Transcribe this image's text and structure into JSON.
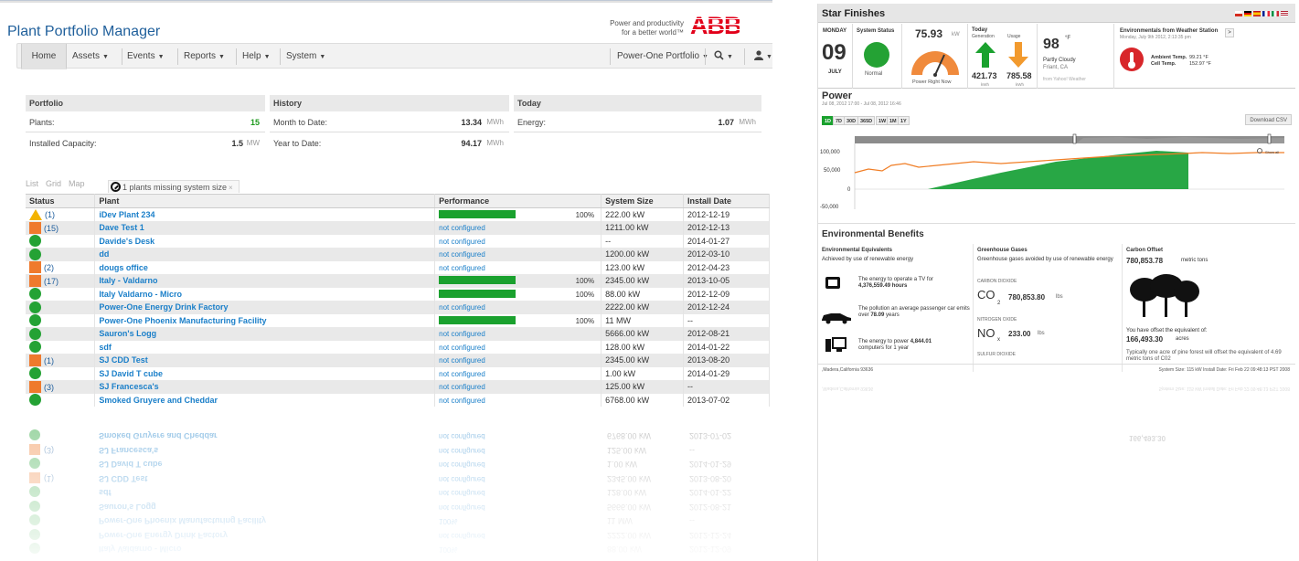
{
  "app": {
    "title": "Plant Portfolio Manager",
    "tagline_1": "Power and productivity",
    "tagline_2": "for a better world™",
    "logo_text": "ABB"
  },
  "nav": {
    "home": "Home",
    "assets": "Assets",
    "events": "Events",
    "reports": "Reports",
    "help": "Help",
    "system": "System",
    "portfolio": "Power-One Portfolio",
    "search_icon": "search-icon",
    "user_icon": "user-icon"
  },
  "summary": {
    "portfolio": {
      "title": "Portfolio",
      "plants_label": "Plants:",
      "plants_value": "15",
      "capacity_label": "Installed Capacity:",
      "capacity_value": "1.5",
      "capacity_unit": "MW"
    },
    "history": {
      "title": "History",
      "mtd_label": "Month to Date:",
      "mtd_value": "13.34",
      "mtd_unit": "MWh",
      "ytd_label": "Year to Date:",
      "ytd_value": "94.17",
      "ytd_unit": "MWh"
    },
    "today": {
      "title": "Today",
      "energy_label": "Energy:",
      "energy_value": "1.07",
      "energy_unit": "MWh"
    }
  },
  "tabs": {
    "list": "List",
    "grid": "Grid",
    "map": "Map",
    "missing": "1 plants missing system size"
  },
  "table": {
    "headers": [
      "Status",
      "Plant",
      "Performance",
      "System Size",
      "Install Date"
    ],
    "rows": [
      {
        "status": "warning",
        "count": "(1)",
        "plant": "iDev Plant 234",
        "perf": "100%",
        "size": "222.00 kW",
        "date": "2012-12-19"
      },
      {
        "status": "orange",
        "count": "(15)",
        "plant": "Dave Test 1",
        "perf": "not configured",
        "size": "1211.00 kW",
        "date": "2012-12-13"
      },
      {
        "status": "green",
        "count": "",
        "plant": "Davide's Desk",
        "perf": "not configured",
        "size": "--",
        "date": "2014-01-27"
      },
      {
        "status": "green",
        "count": "",
        "plant": "dd",
        "perf": "not configured",
        "size": "1200.00 kW",
        "date": "2012-03-10"
      },
      {
        "status": "orange",
        "count": "(2)",
        "plant": "dougs office",
        "perf": "not configured",
        "size": "123.00 kW",
        "date": "2012-04-23"
      },
      {
        "status": "orange",
        "count": "(17)",
        "plant": "Italy - Valdarno",
        "perf": "100%",
        "size": "2345.00 kW",
        "date": "2013-10-05"
      },
      {
        "status": "green",
        "count": "",
        "plant": "Italy Valdarno - Micro",
        "perf": "100%",
        "size": "88.00 kW",
        "date": "2012-12-09"
      },
      {
        "status": "green",
        "count": "",
        "plant": "Power-One Energy Drink Factory",
        "perf": "not configured",
        "size": "2222.00 kW",
        "date": "2012-12-24"
      },
      {
        "status": "green",
        "count": "",
        "plant": "Power-One Phoenix Manufacturing Facility",
        "perf": "100%",
        "size": "11 MW",
        "date": "--"
      },
      {
        "status": "green",
        "count": "",
        "plant": "Sauron's Logg",
        "perf": "not configured",
        "size": "5666.00 kW",
        "date": "2012-08-21"
      },
      {
        "status": "green",
        "count": "",
        "plant": "sdf",
        "perf": "not configured",
        "size": "128.00 kW",
        "date": "2014-01-22"
      },
      {
        "status": "orange",
        "count": "(1)",
        "plant": "SJ CDD Test",
        "perf": "not configured",
        "size": "2345.00 kW",
        "date": "2013-08-20"
      },
      {
        "status": "green",
        "count": "",
        "plant": "SJ David T cube",
        "perf": "not configured",
        "size": "1.00 kW",
        "date": "2014-01-29"
      },
      {
        "status": "orange",
        "count": "(3)",
        "plant": "SJ Francesca's",
        "perf": "not configured",
        "size": "125.00 kW",
        "date": "--"
      },
      {
        "status": "green",
        "count": "",
        "plant": "Smoked Gruyere and Cheddar",
        "perf": "not configured",
        "size": "6768.00 kW",
        "date": "2013-07-02"
      }
    ]
  },
  "starfinishes": {
    "title": "Star Finishes",
    "day": "MONDAY",
    "date": "09",
    "month": "JULY",
    "status_label": "System Status",
    "status_text": "Normal",
    "power_value": "75.93",
    "power_unit": "kW",
    "power_caption": "Power Right Now",
    "today_label": "Today",
    "generation_label": "Generation",
    "usage_label": "Usage",
    "generation_value": "421.73",
    "usage_value": "785.58",
    "kwh": "kWh",
    "temp": "98",
    "temp_unit": "°F",
    "weather": "Partly Cloudy",
    "location": "Friant, CA",
    "weather_source": "from Yahoo! Weather",
    "env_title": "Environmentals from Weather Station",
    "env_date": "Monday, July 9th 2012, 2:13:35 pm",
    "ambient_label": "Ambient Temp.",
    "ambient_value": "99.21 °F",
    "cell_label": "Cell Temp.",
    "cell_value": "152.97 °F",
    "power_title": "Power",
    "power_range": "Jul 08, 2012 17:00 - Jul 08, 2012 16:46",
    "ranges": [
      "1D",
      "7D",
      "30D",
      "365D",
      "1W",
      "1M",
      "1Y"
    ],
    "download": "Download CSV",
    "y_ticks": [
      "100,000",
      "50,000",
      "0",
      "-50,000"
    ],
    "show_all": "Show all",
    "env_benefits": "Environmental Benefits",
    "eq_title": "Environmental Equivalents",
    "eq_sub": "Achieved by use of renewable energy",
    "eq_tv": "The energy to operate a TV for",
    "eq_tv_val": "4,376,559.49 hours",
    "eq_car": "The pollution an average passenger car emits over",
    "eq_car_val": "78.09",
    "eq_car_unit": "years",
    "eq_pc": "The energy to power",
    "eq_pc_val": "4,844.01",
    "eq_pc_tail": "computers for 1 year",
    "gg_title": "Greenhouse Gases",
    "gg_sub": "Greenhouse gases avoided by use of renewable energy",
    "co2_label": "CARBON DIOXIDE",
    "co2_sym": "CO",
    "co2_sub": "2",
    "co2_val": "780,853.80",
    "co2_unit": "lbs",
    "nox_label": "NITROGEN OXIDE",
    "nox_sym": "NO",
    "nox_sub": "x",
    "nox_val": "233.00",
    "nox_unit": "lbs",
    "so2_label": "SULFUR DIOXIDE",
    "co_title": "Carbon Offset",
    "co_val": "780,853.78",
    "co_unit": "metric tons",
    "co_offset": "You have offset the equivalent of:",
    "co_acres": "166,493.30",
    "co_acres_unit": "acres",
    "co_note": "Typically one acre of pine forest will offset the equivalent of 4.69 metric tons of C02",
    "footer_loc": ",Madera,California 93636",
    "footer_info": "System Size: 115 kW  Install Date: Fri Feb 22 09:48:13 PST 2008"
  },
  "colors": {
    "green": "#1aa12e",
    "orange": "#ef7a2d",
    "warning": "#f3b300",
    "link": "#1a7fc9",
    "abb_red": "#e2001a"
  }
}
